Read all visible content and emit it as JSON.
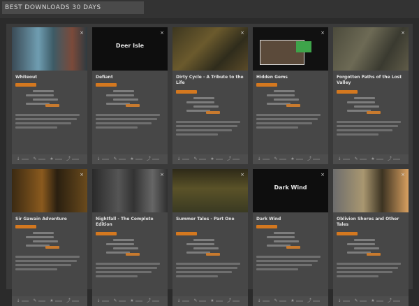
{
  "header": {
    "title": "BEST DOWNLOADS 30 DAYS"
  },
  "cards": [
    {
      "title": "Whiteout",
      "thumb_caption": "",
      "thumb_style": "scene-blue"
    },
    {
      "title": "Defiant",
      "thumb_caption": "Deer Isle",
      "thumb_style": "black"
    },
    {
      "title": "Dirty Cycle - A Tribute to the Life",
      "thumb_caption": "",
      "thumb_style": "scene-olive"
    },
    {
      "title": "Hidden Gems",
      "thumb_caption": "",
      "thumb_style": "scene-ui"
    },
    {
      "title": "Forgotten Paths of the Lost Valley",
      "thumb_caption": "",
      "thumb_style": "scene-figure"
    },
    {
      "title": "Sir Gawain Adventure",
      "thumb_caption": "",
      "thumb_style": "scene-amber"
    },
    {
      "title": "Nightfall - The Complete Edition",
      "thumb_caption": "",
      "thumb_style": "scene-gray"
    },
    {
      "title": "Summer Tales - Part One",
      "thumb_caption": "",
      "thumb_style": "scene-forest"
    },
    {
      "title": "Dark Wind",
      "thumb_caption": "Dark Wind",
      "thumb_style": "black"
    },
    {
      "title": "Oblivion Shores and Other Tales",
      "thumb_caption": "",
      "thumb_style": "scene-sunset"
    }
  ],
  "icons": {
    "close": "close-icon",
    "footer": [
      "download-icon",
      "comment-icon",
      "star-icon",
      "share-icon"
    ]
  },
  "colors": {
    "accent": "#d4781f",
    "card": "#474747",
    "background": "#2b2b2b"
  }
}
